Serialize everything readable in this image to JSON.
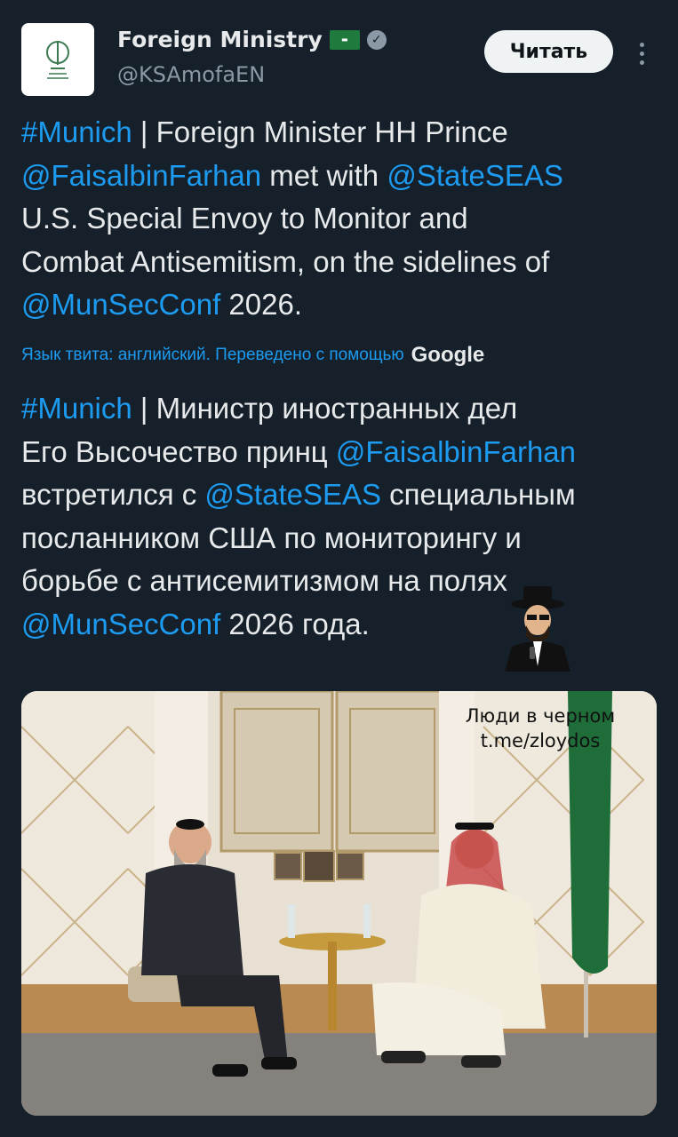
{
  "header": {
    "display_name": "Foreign Ministry",
    "handle": "@KSAmofaEN",
    "follow_label": "Читать",
    "flag_icon": "saudi-flag-icon",
    "verified_icon": "verified-badge-icon"
  },
  "tweet_original": {
    "lines": [
      [
        {
          "t": "#Munich",
          "link": true
        },
        {
          "t": " | Foreign Minister HH Prince",
          "link": false
        }
      ],
      [
        {
          "t": "@FaisalbinFarhan",
          "link": true
        },
        {
          "t": " met with ",
          "link": false
        },
        {
          "t": "@StateSEAS",
          "link": true
        }
      ],
      [
        {
          "t": "U.S. Special Envoy to Monitor and",
          "link": false
        }
      ],
      [
        {
          "t": "Combat Antisemitism, on the sidelines of",
          "link": false
        }
      ],
      [
        {
          "t": "@MunSecConf",
          "link": true
        },
        {
          "t": " 2026.",
          "link": false
        }
      ]
    ]
  },
  "translation_note": {
    "text": "Язык твита: английский. Переведено с помощью",
    "provider": "Google"
  },
  "tweet_translated": {
    "lines": [
      [
        {
          "t": "#Munich",
          "link": true
        },
        {
          "t": " | Министр иностранных дел",
          "link": false
        }
      ],
      [
        {
          "t": "Его Высочество принц ",
          "link": false
        },
        {
          "t": "@FaisalbinFarhan",
          "link": true
        }
      ],
      [
        {
          "t": "встретился с ",
          "link": false
        },
        {
          "t": "@StateSEAS",
          "link": true
        },
        {
          "t": " специальным",
          "link": false
        }
      ],
      [
        {
          "t": "посланником США по мониторингу и",
          "link": false
        }
      ],
      [
        {
          "t": "борьбе с антисемитизмом на полях",
          "link": false
        }
      ],
      [
        {
          "t": "@MunSecConf",
          "link": true
        },
        {
          "t": " 2026 года.",
          "link": false
        }
      ]
    ]
  },
  "watermark": {
    "line1": "Люди в черном",
    "line2": "t.me/zloydos"
  },
  "colors": {
    "background": "#15202b",
    "link": "#1d9bf0",
    "text": "#e7e9ea",
    "muted": "#8b98a5"
  }
}
